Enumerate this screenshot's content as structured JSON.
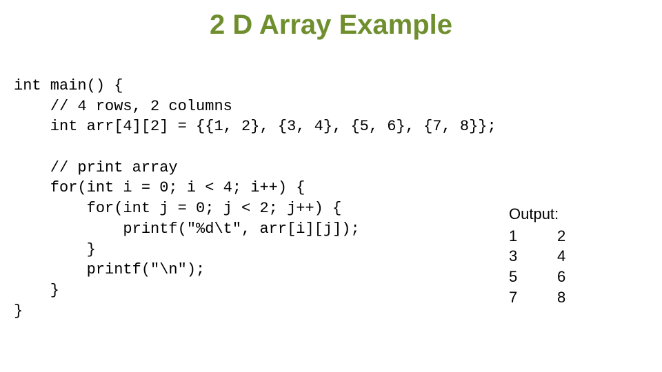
{
  "title": "2 D Array Example",
  "code": {
    "line1": "int main() {",
    "line2": "    // 4 rows, 2 columns",
    "line3": "    int arr[4][2] = {{1, 2}, {3, 4}, {5, 6}, {7, 8}};",
    "line4": "",
    "line5": "    // print array",
    "line6": "    for(int i = 0; i < 4; i++) {",
    "line7": "        for(int j = 0; j < 2; j++) {",
    "line8": "            printf(\"%d\\t\", arr[i][j]);",
    "line9": "        }",
    "line10": "        printf(\"\\n\");",
    "line11": "    }",
    "line12": "}"
  },
  "output": {
    "label": "Output:",
    "rows": [
      {
        "a": "1",
        "b": "2"
      },
      {
        "a": "3",
        "b": "4"
      },
      {
        "a": "5",
        "b": "6"
      },
      {
        "a": "7",
        "b": "8"
      }
    ]
  }
}
